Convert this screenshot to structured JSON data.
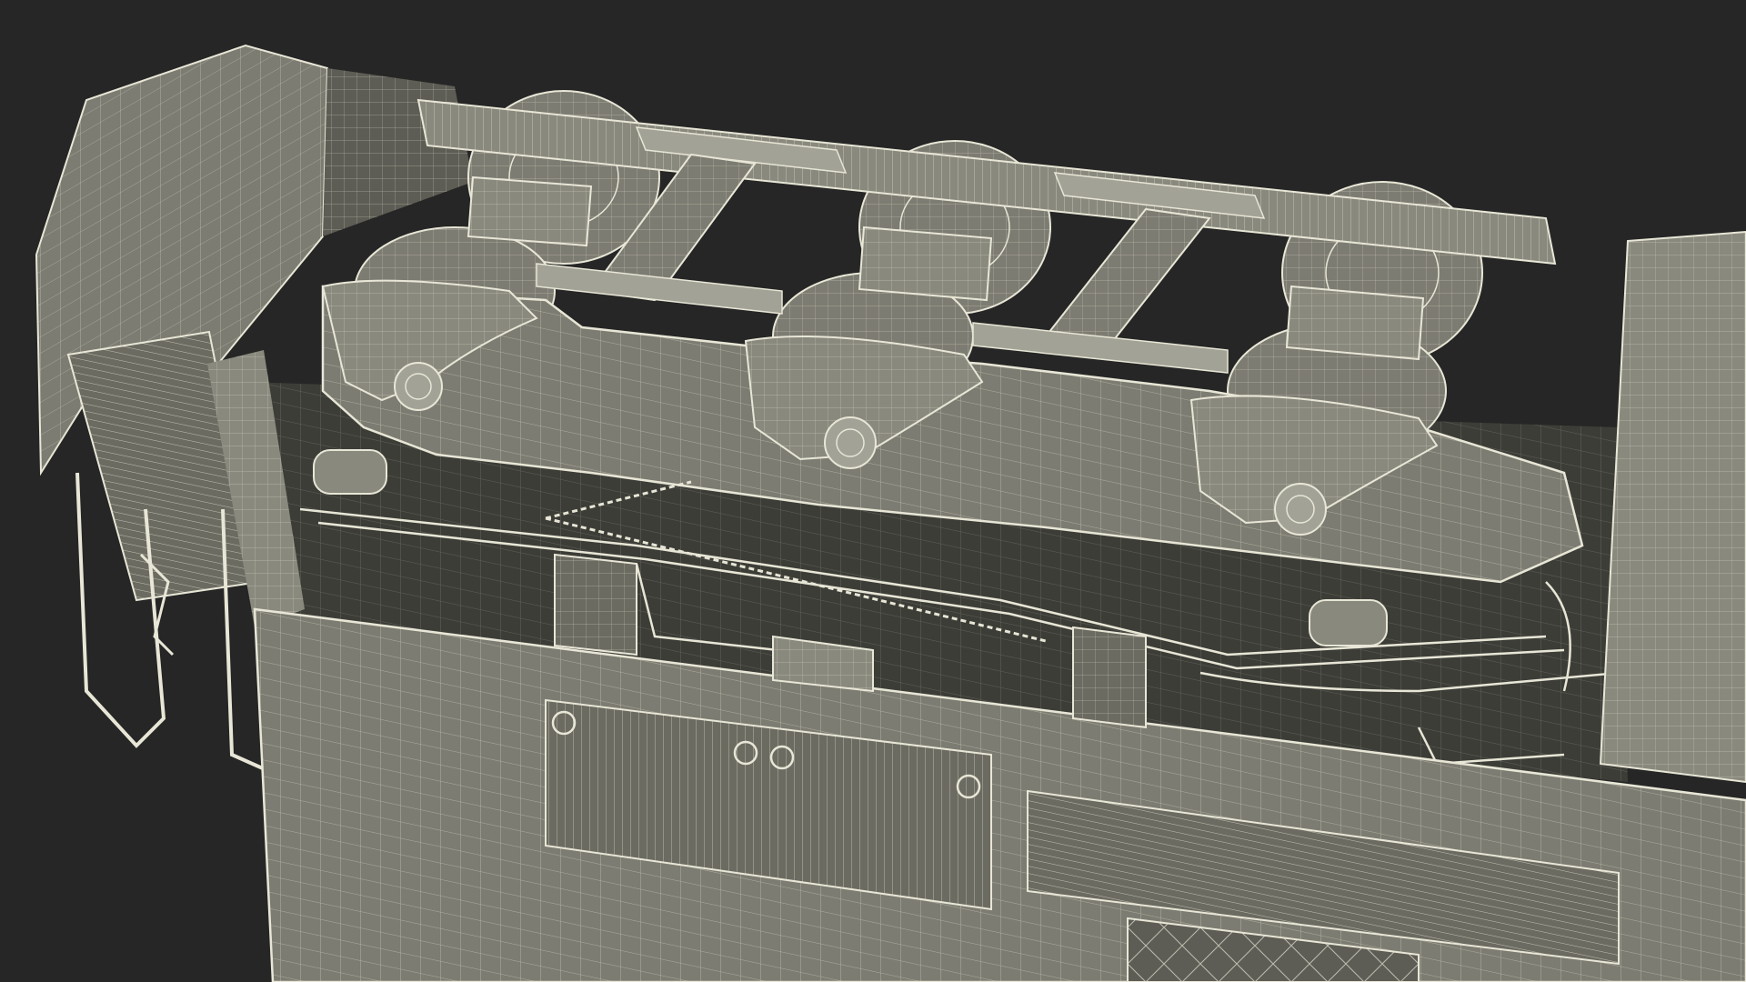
{
  "scene": {
    "background_color": "#262626",
    "mesh_fill": "#7d7c72",
    "mesh_fill_dark": "#5e5d55",
    "mesh_fill_shadow": "#3d3d38",
    "wire_color": "#e8e6d6",
    "wheel_count": 6,
    "bogie_count": 1
  }
}
